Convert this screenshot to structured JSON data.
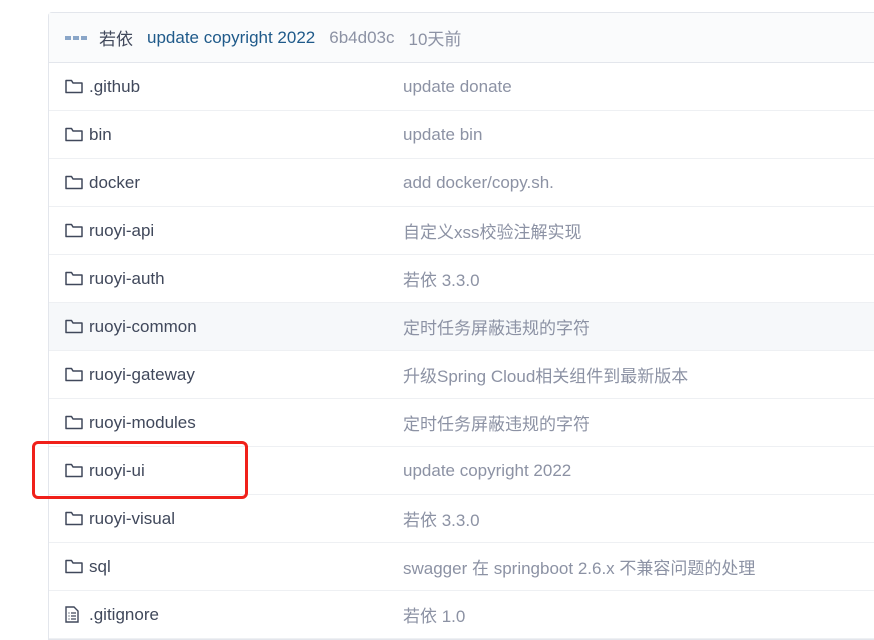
{
  "last_commit": {
    "author": "若依",
    "message": "update copyright 2022",
    "sha": "6b4d03c",
    "time": "10天前"
  },
  "files": [
    {
      "name": ".github",
      "type": "folder",
      "message": "update donate"
    },
    {
      "name": "bin",
      "type": "folder",
      "message": "update bin"
    },
    {
      "name": "docker",
      "type": "folder",
      "message": "add docker/copy.sh."
    },
    {
      "name": "ruoyi-api",
      "type": "folder",
      "message": "自定义xss校验注解实现"
    },
    {
      "name": "ruoyi-auth",
      "type": "folder",
      "message": "若依 3.3.0"
    },
    {
      "name": "ruoyi-common",
      "type": "folder",
      "message": "定时任务屏蔽违规的字符",
      "hovered": true
    },
    {
      "name": "ruoyi-gateway",
      "type": "folder",
      "message": "升级Spring Cloud相关组件到最新版本"
    },
    {
      "name": "ruoyi-modules",
      "type": "folder",
      "message": "定时任务屏蔽违规的字符"
    },
    {
      "name": "ruoyi-ui",
      "type": "folder",
      "message": "update copyright 2022",
      "highlighted": true
    },
    {
      "name": "ruoyi-visual",
      "type": "folder",
      "message": "若依 3.3.0"
    },
    {
      "name": "sql",
      "type": "folder",
      "message": "swagger 在 springboot 2.6.x 不兼容问题的处理"
    },
    {
      "name": ".gitignore",
      "type": "file",
      "message": "若依 1.0"
    }
  ],
  "colors": {
    "highlight_box": "#f0201a",
    "commit_message": "#1f5a8a"
  }
}
